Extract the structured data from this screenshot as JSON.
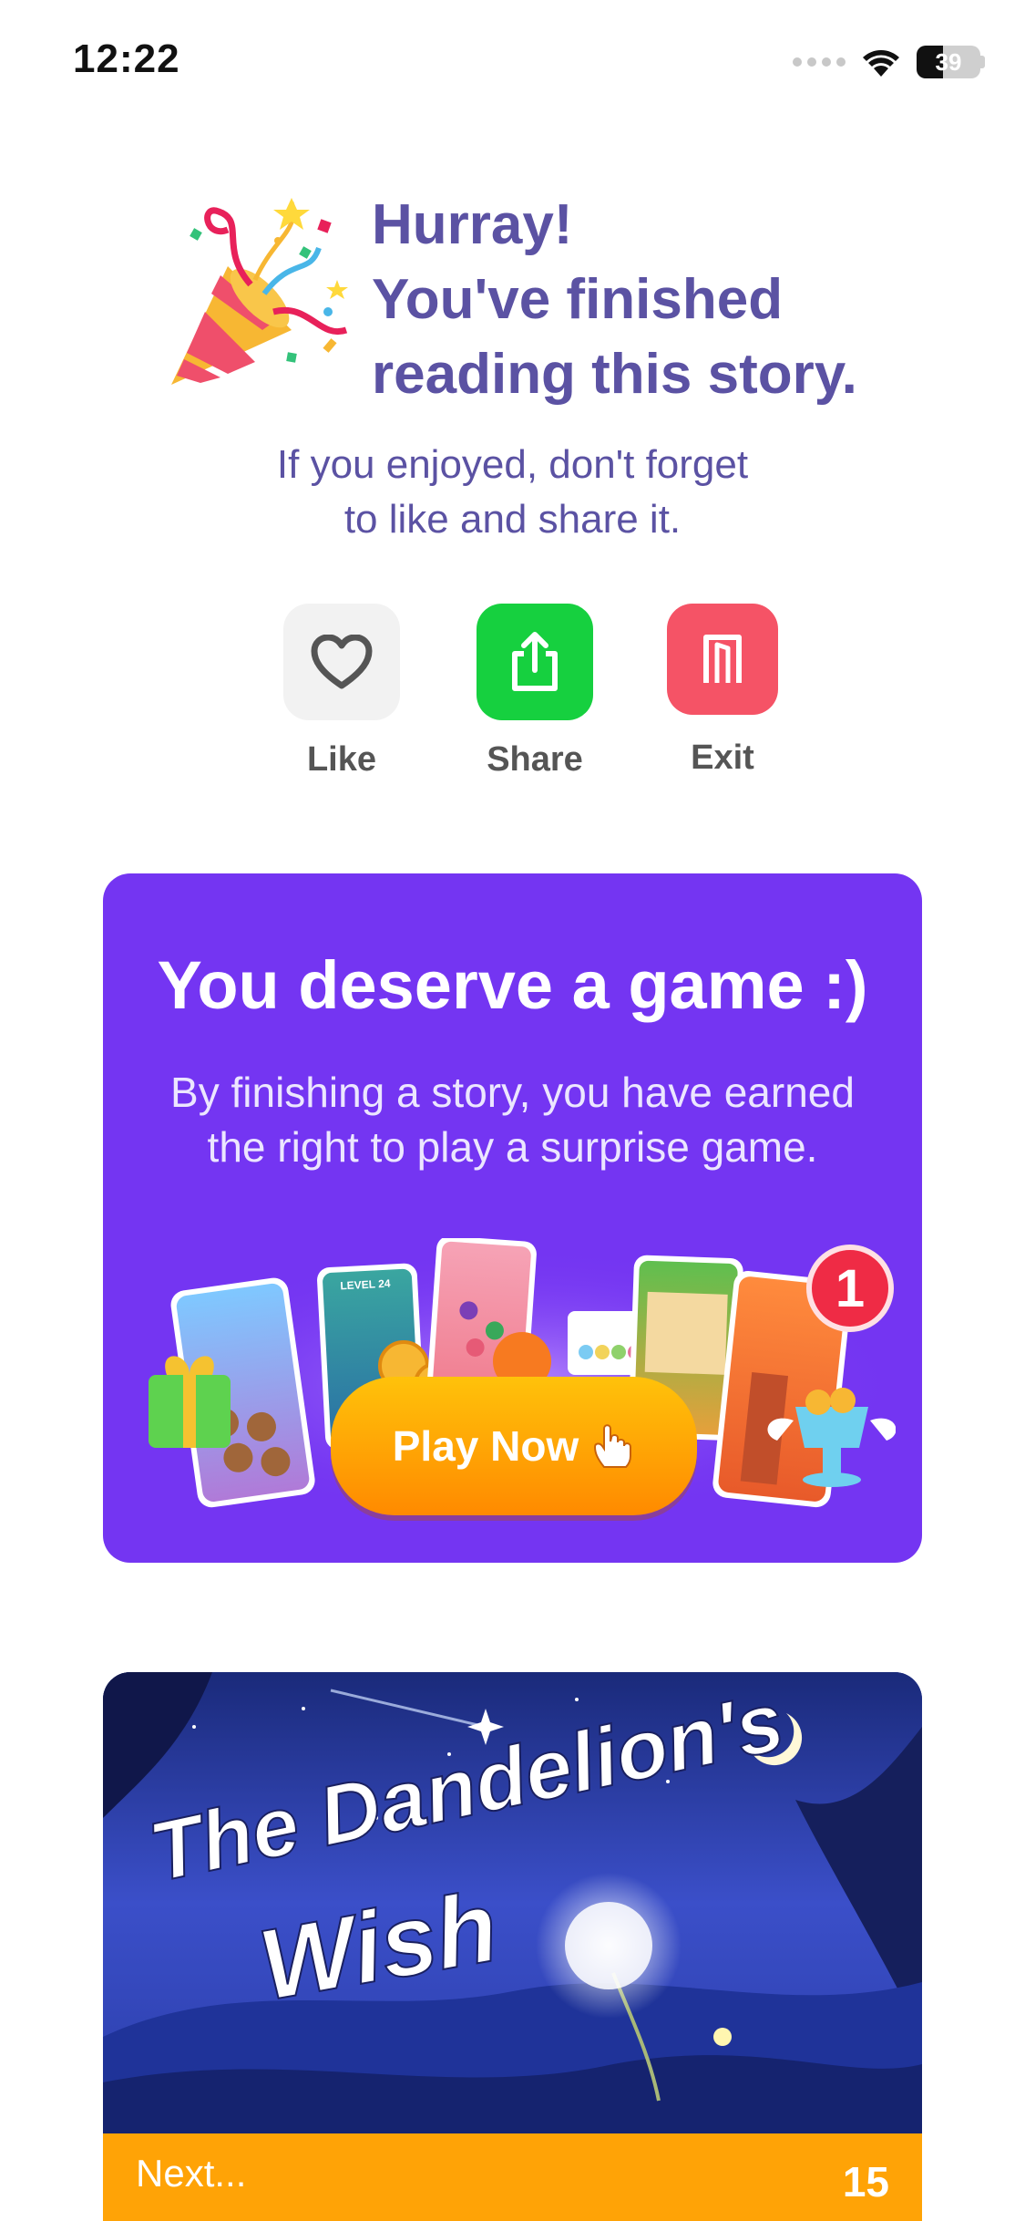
{
  "status_bar": {
    "time": "12:22",
    "battery": "39"
  },
  "header": {
    "title_lines": [
      "Hurray!",
      "You've finished",
      "reading this story."
    ],
    "subtitle_lines": [
      "If you enjoyed, don't forget",
      "to like and share it."
    ]
  },
  "actions": {
    "like": "Like",
    "share": "Share",
    "exit": "Exit"
  },
  "game_card": {
    "title": "You deserve a game :)",
    "subtitle_lines": [
      "By finishing a story, you have earned",
      "the right to play a surprise game."
    ],
    "play_label": "Play Now",
    "level_text": "LEVEL 24",
    "badge_number": "1"
  },
  "story_card": {
    "title_line1": "The Dandelion's",
    "title_line2": "Wish",
    "next_label": "Next...",
    "next_count": "15"
  },
  "colors": {
    "title_purple": "#5b52a3",
    "card_purple": "#7435f2",
    "share_green": "#16d03f",
    "exit_red": "#f55366",
    "play_orange": "#ff8a00",
    "next_bar": "#ffa306"
  }
}
